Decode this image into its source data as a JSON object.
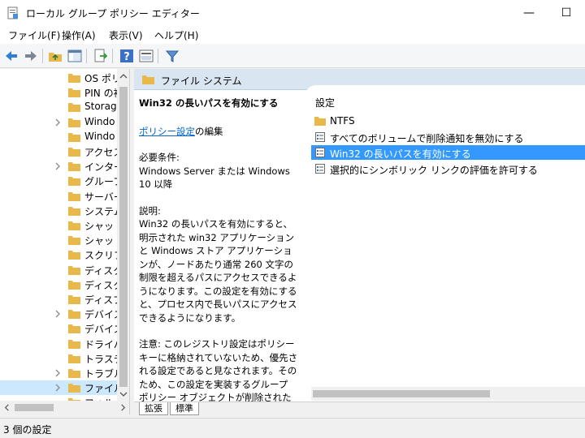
{
  "window": {
    "title": "ローカル グループ ポリシー エディター",
    "minimize_glyph": "—",
    "maximize_glyph": "☐"
  },
  "menu": [
    "ファイル(F)",
    "操作(A)",
    "表示(V)",
    "ヘルプ(H)"
  ],
  "toolbar": {
    "icons": [
      "back-arrow-icon",
      "forward-arrow-icon",
      "folder-up-icon",
      "show-hide-tree-icon",
      "export-list-icon",
      "help-icon",
      "properties-view-icon",
      "filter-icon"
    ]
  },
  "tree": {
    "items": [
      {
        "label": "OS ポリ",
        "expandable": false
      },
      {
        "label": "PIN の複",
        "expandable": false
      },
      {
        "label": "Storag",
        "expandable": false
      },
      {
        "label": "Windo",
        "expandable": true
      },
      {
        "label": "Windo",
        "expandable": false
      },
      {
        "label": "アクセス",
        "expandable": false
      },
      {
        "label": "インター",
        "expandable": true
      },
      {
        "label": "グループ",
        "expandable": false
      },
      {
        "label": "サーバー",
        "expandable": false
      },
      {
        "label": "システム",
        "expandable": false
      },
      {
        "label": "シャット",
        "expandable": false
      },
      {
        "label": "シャット",
        "expandable": false
      },
      {
        "label": "スクリプ",
        "expandable": false
      },
      {
        "label": "ディスク",
        "expandable": false
      },
      {
        "label": "ディスク",
        "expandable": false
      },
      {
        "label": "ディスプ",
        "expandable": false
      },
      {
        "label": "デバイス",
        "expandable": true
      },
      {
        "label": "デバイス",
        "expandable": false
      },
      {
        "label": "ドライバ",
        "expandable": false
      },
      {
        "label": "トラステ",
        "expandable": false
      },
      {
        "label": "トラブル",
        "expandable": true
      },
      {
        "label": "ファイル",
        "expandable": true,
        "selected": true
      },
      {
        "label": "フォル",
        "expandable": false
      }
    ]
  },
  "right": {
    "header": "ファイル システム",
    "description": {
      "title": "Win32 の長いパスを有効にする",
      "edit_link": "ポリシー設定",
      "edit_suffix": "の編集",
      "requirements_label": "必要条件:",
      "requirements_text": "Windows Server または Windows 10 以降",
      "explanation_label": "説明:",
      "explanation_text": "Win32 の長いパスを有効にすると、明示された win32 アプリケーションと Windows ストア アプリケーションが、ノードあたり通常 260 文字の制限を超えるパスにアクセスできるようになります。この設定を有効にすると、プロセス内で長いパスにアクセスできるようになります。",
      "note_text": "注意: このレジストリ設定はポリシー キーに格納されていないため、優先される設定であると見なされます。そのため、この設定を実装するグループ ポリシー オブジェクトが削除された場合、このレジストリ設定は残ります。"
    },
    "list": {
      "column": "設定",
      "items": [
        {
          "label": "NTFS",
          "icon": "folder-icon"
        },
        {
          "label": "すべてのボリュームで削除通知を無効にする",
          "icon": "policy-setting-icon"
        },
        {
          "label": "Win32 の長いパスを有効にする",
          "icon": "policy-setting-icon",
          "selected": true
        },
        {
          "label": "選択的にシンボリック リンクの評価を許可する",
          "icon": "policy-setting-icon"
        }
      ]
    },
    "tabs": [
      "拡張",
      "標準"
    ]
  },
  "status": "3 個の設定",
  "colors": {
    "selection": "#3399ff",
    "header_band": "#d9e6f2",
    "link": "#0066cc",
    "folder": "#e8b84a"
  }
}
